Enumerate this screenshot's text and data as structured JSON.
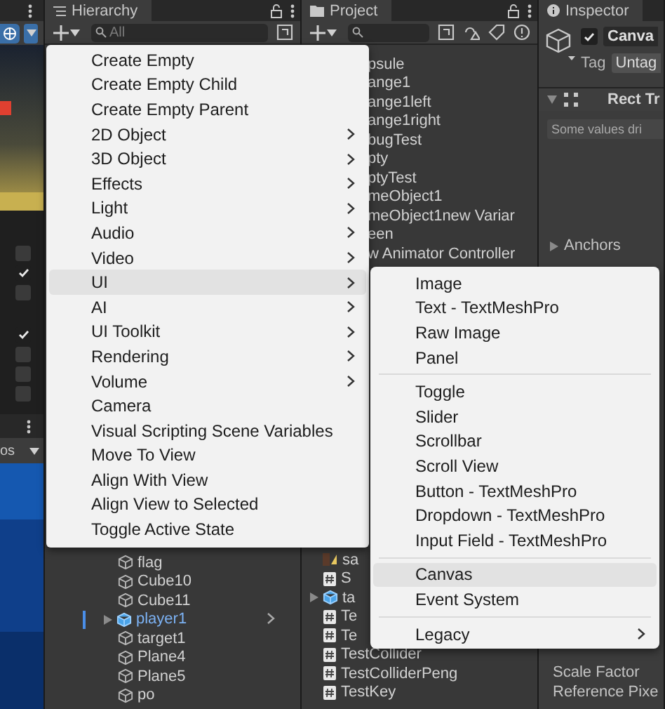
{
  "scene_view": {
    "checkbox_groups": [
      [
        {
          "checked": false
        },
        {
          "checked": true
        },
        {
          "checked": false
        }
      ],
      [
        {
          "checked": true
        },
        {
          "checked": false
        },
        {
          "checked": false
        },
        {
          "checked": false
        }
      ]
    ],
    "bar_label": "os"
  },
  "hierarchy": {
    "title": "Hierarchy",
    "search": {
      "placeholder": "All"
    },
    "items": [
      {
        "label": "flag",
        "kind": "object"
      },
      {
        "label": "Cube10",
        "kind": "object"
      },
      {
        "label": "Cube11",
        "kind": "object"
      },
      {
        "label": "player1",
        "kind": "prefab"
      },
      {
        "label": "target1",
        "kind": "object"
      },
      {
        "label": "Plane4",
        "kind": "object"
      },
      {
        "label": "Plane5",
        "kind": "object"
      },
      {
        "label": "po",
        "kind": "object"
      }
    ]
  },
  "project": {
    "title": "Project",
    "top_rows": [
      "psule",
      "ange1",
      "ange1left",
      "ange1right",
      "bugTest",
      "pty",
      "ptyTest",
      "meObject1",
      "meObject1new Variar",
      "een",
      "w Animator Controller"
    ],
    "bottom_rows": [
      {
        "label": "sa",
        "kind": "material"
      },
      {
        "label": "S",
        "kind": "script"
      },
      {
        "label": "ta",
        "kind": "prefab"
      },
      {
        "label": "Te",
        "kind": "script"
      },
      {
        "label": "Te",
        "kind": "script"
      },
      {
        "label": "TestCollider",
        "kind": "script"
      },
      {
        "label": "TestColliderPeng",
        "kind": "script"
      },
      {
        "label": "TestKey",
        "kind": "script"
      }
    ]
  },
  "inspector": {
    "title": "Inspector",
    "active": true,
    "name": "Canva",
    "tag_label": "Tag",
    "tag_value": "Untag",
    "component": "Rect Tr",
    "notice": "Some values dri",
    "foldout": "Anchors",
    "fields": [
      "Scale Factor",
      "Reference Pixe"
    ]
  },
  "context_menu": {
    "items": [
      {
        "label": "Create Empty",
        "has_submenu": false,
        "selected": false
      },
      {
        "label": "Create Empty Child",
        "has_submenu": false,
        "selected": false
      },
      {
        "label": "Create Empty Parent",
        "has_submenu": false,
        "selected": false
      },
      {
        "label": "2D Object",
        "has_submenu": true,
        "selected": false
      },
      {
        "label": "3D Object",
        "has_submenu": true,
        "selected": false
      },
      {
        "label": "Effects",
        "has_submenu": true,
        "selected": false
      },
      {
        "label": "Light",
        "has_submenu": true,
        "selected": false
      },
      {
        "label": "Audio",
        "has_submenu": true,
        "selected": false
      },
      {
        "label": "Video",
        "has_submenu": true,
        "selected": false
      },
      {
        "label": "UI",
        "has_submenu": true,
        "selected": true
      },
      {
        "label": "AI",
        "has_submenu": true,
        "selected": false
      },
      {
        "label": "UI Toolkit",
        "has_submenu": true,
        "selected": false
      },
      {
        "label": "Rendering",
        "has_submenu": true,
        "selected": false
      },
      {
        "label": "Volume",
        "has_submenu": true,
        "selected": false
      },
      {
        "label": "Camera",
        "has_submenu": false,
        "selected": false
      },
      {
        "label": "Visual Scripting Scene Variables",
        "has_submenu": false,
        "selected": false
      },
      {
        "label": "Move To View",
        "has_submenu": false,
        "selected": false
      },
      {
        "label": "Align With View",
        "has_submenu": false,
        "selected": false
      },
      {
        "label": "Align View to Selected",
        "has_submenu": false,
        "selected": false
      },
      {
        "label": "Toggle Active State",
        "has_submenu": false,
        "selected": false
      }
    ]
  },
  "submenu": {
    "groups": [
      [
        {
          "label": "Image",
          "has_submenu": false,
          "selected": false
        },
        {
          "label": "Text - TextMeshPro",
          "has_submenu": false,
          "selected": false
        },
        {
          "label": "Raw Image",
          "has_submenu": false,
          "selected": false
        },
        {
          "label": "Panel",
          "has_submenu": false,
          "selected": false
        }
      ],
      [
        {
          "label": "Toggle",
          "has_submenu": false,
          "selected": false
        },
        {
          "label": "Slider",
          "has_submenu": false,
          "selected": false
        },
        {
          "label": "Scrollbar",
          "has_submenu": false,
          "selected": false
        },
        {
          "label": "Scroll View",
          "has_submenu": false,
          "selected": false
        },
        {
          "label": "Button - TextMeshPro",
          "has_submenu": false,
          "selected": false
        },
        {
          "label": "Dropdown - TextMeshPro",
          "has_submenu": false,
          "selected": false
        },
        {
          "label": "Input Field - TextMeshPro",
          "has_submenu": false,
          "selected": false
        }
      ],
      [
        {
          "label": "Canvas",
          "has_submenu": false,
          "selected": true
        },
        {
          "label": "Event System",
          "has_submenu": false,
          "selected": false
        }
      ],
      [
        {
          "label": "Legacy",
          "has_submenu": true,
          "selected": false
        }
      ]
    ]
  }
}
